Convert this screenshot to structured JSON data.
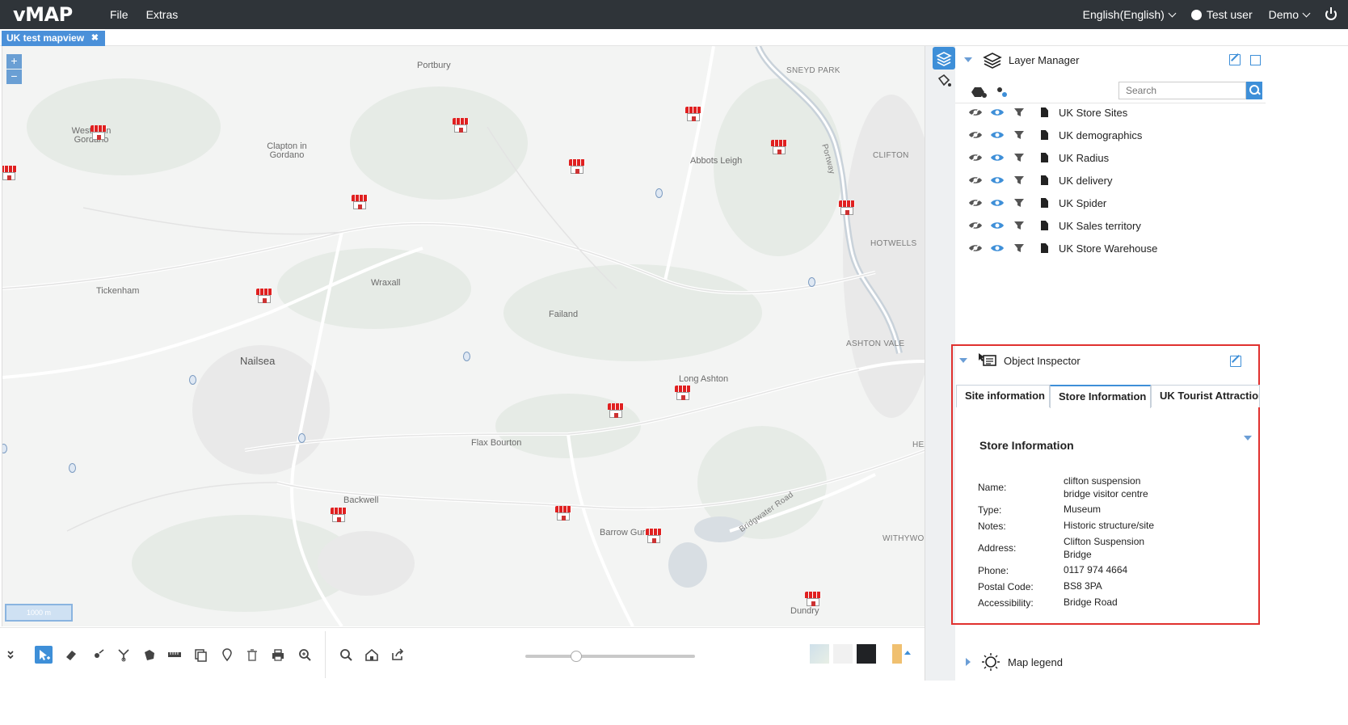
{
  "app": {
    "logo": "vMAP",
    "menu": [
      "File",
      "Extras"
    ],
    "language": "English(English)",
    "user": "Test user",
    "account": "Demo"
  },
  "map_tab": {
    "label": "UK test mapview",
    "close": "✖"
  },
  "map": {
    "zoom_in": "+",
    "zoom_out": "−",
    "scale_label": "1000 m",
    "places": [
      {
        "name": "Portbury",
        "cls": "place"
      },
      {
        "name": "SNEYD PARK",
        "cls": "place small"
      },
      {
        "name": "Weston in Gordano",
        "cls": "place"
      },
      {
        "name": "Clapton in Gordano",
        "cls": "place"
      },
      {
        "name": "Abbots Leigh",
        "cls": "place"
      },
      {
        "name": "CLIFTON",
        "cls": "place small"
      },
      {
        "name": "HOTWELLS",
        "cls": "place small"
      },
      {
        "name": "Tickenham",
        "cls": "place"
      },
      {
        "name": "Wraxall",
        "cls": "place"
      },
      {
        "name": "Failand",
        "cls": "place"
      },
      {
        "name": "ASHTON VALE",
        "cls": "place small"
      },
      {
        "name": "Nailsea",
        "cls": "place big"
      },
      {
        "name": "Long Ashton",
        "cls": "place"
      },
      {
        "name": "Flax Bourton",
        "cls": "place"
      },
      {
        "name": "Backwell",
        "cls": "place"
      },
      {
        "name": "Barrow Gurney",
        "cls": "place"
      },
      {
        "name": "WITHYWOOD",
        "cls": "place small"
      },
      {
        "name": "Dundry",
        "cls": "place"
      },
      {
        "name": "Portway",
        "cls": "place small"
      },
      {
        "name": "Bridgwater Road",
        "cls": "place small"
      },
      {
        "name": "HEA",
        "cls": "place small"
      }
    ]
  },
  "toolbar": {
    "icons": [
      "collapse-icon",
      "select-icon",
      "erase-icon",
      "draw-point-icon",
      "split-icon",
      "polygon-icon",
      "measure-icon",
      "copy-icon",
      "map-pin-icon",
      "delete-icon",
      "print-icon",
      "zoom-area-icon",
      "search-icon",
      "home-icon",
      "share-icon"
    ],
    "opacity_percent": 30
  },
  "layer_manager": {
    "title": "Layer Manager",
    "search_placeholder": "Search",
    "layers": [
      "UK Store Sites",
      "UK demographics",
      "UK Radius",
      "UK delivery",
      "UK Spider",
      "UK Sales territory",
      "UK Store Warehouse"
    ]
  },
  "object_inspector": {
    "title": "Object Inspector",
    "tabs": [
      "Site information",
      "Store Information",
      "UK Tourist Attractions"
    ],
    "section_title": "Store Information",
    "fields": [
      {
        "label": "Name:",
        "value": "clifton suspension bridge visitor centre"
      },
      {
        "label": "Type:",
        "value": "Museum"
      },
      {
        "label": "Notes:",
        "value": "Historic structure/site"
      },
      {
        "label": "Address:",
        "value": "Clifton Suspension Bridge"
      },
      {
        "label": "Phone:",
        "value": "0117 974 4664"
      },
      {
        "label": "Postal Code:",
        "value": "BS8 3PA"
      },
      {
        "label": "Accessibility:",
        "value": "Bridge Road"
      }
    ]
  },
  "map_legend": {
    "title": "Map legend"
  },
  "colors": {
    "topbar": "#2f3439",
    "accent": "#3e8fd8",
    "highlight_border": "#e0312f"
  }
}
